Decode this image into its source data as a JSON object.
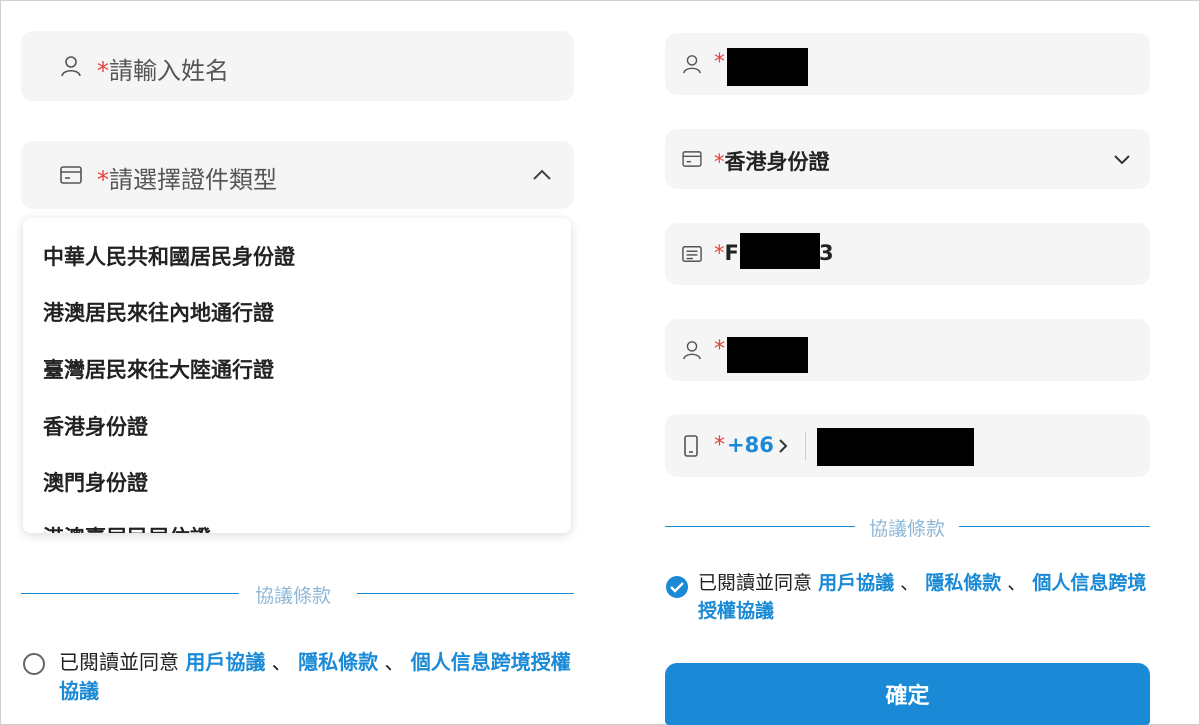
{
  "left": {
    "name_field": {
      "required_mark": "*",
      "placeholder": "請輸入姓名"
    },
    "id_type_field": {
      "required_mark": "*",
      "placeholder": "請選擇證件類型"
    },
    "id_type_options": [
      "中華人民共和國居民身份證",
      "港澳居民來往內地通行證",
      "臺灣居民來往大陸通行證",
      "香港身份證",
      "澳門身份證",
      "港澳臺居民居住證"
    ],
    "terms_divider": "協議條款",
    "agreement": {
      "prefix": "已閱讀並同意",
      "link1": "用戶協議",
      "sep1": "、",
      "link2": "隱私條款",
      "sep2": "、",
      "link3": "個人信息跨境授權協議",
      "checked": false
    }
  },
  "right": {
    "name_field": {
      "required_mark": "*"
    },
    "id_type_field": {
      "required_mark": "*",
      "value": "香港身份證"
    },
    "id_number_field": {
      "required_mark": "*",
      "value_start": "F",
      "value_end": "3"
    },
    "english_name_field": {
      "required_mark": "*"
    },
    "phone_field": {
      "required_mark": "*",
      "country_code": "+86"
    },
    "terms_divider": "協議條款",
    "agreement": {
      "prefix": "已閱讀並同意",
      "link1": "用戶協議",
      "sep1": "、",
      "link2": "隱私條款",
      "sep2": "、",
      "link3": "個人信息跨境授權協議",
      "checked": true
    },
    "confirm_label": "確定"
  },
  "colors": {
    "accent": "#1a8ad6",
    "required": "#e8413b",
    "field_bg": "#f5f5f5"
  }
}
